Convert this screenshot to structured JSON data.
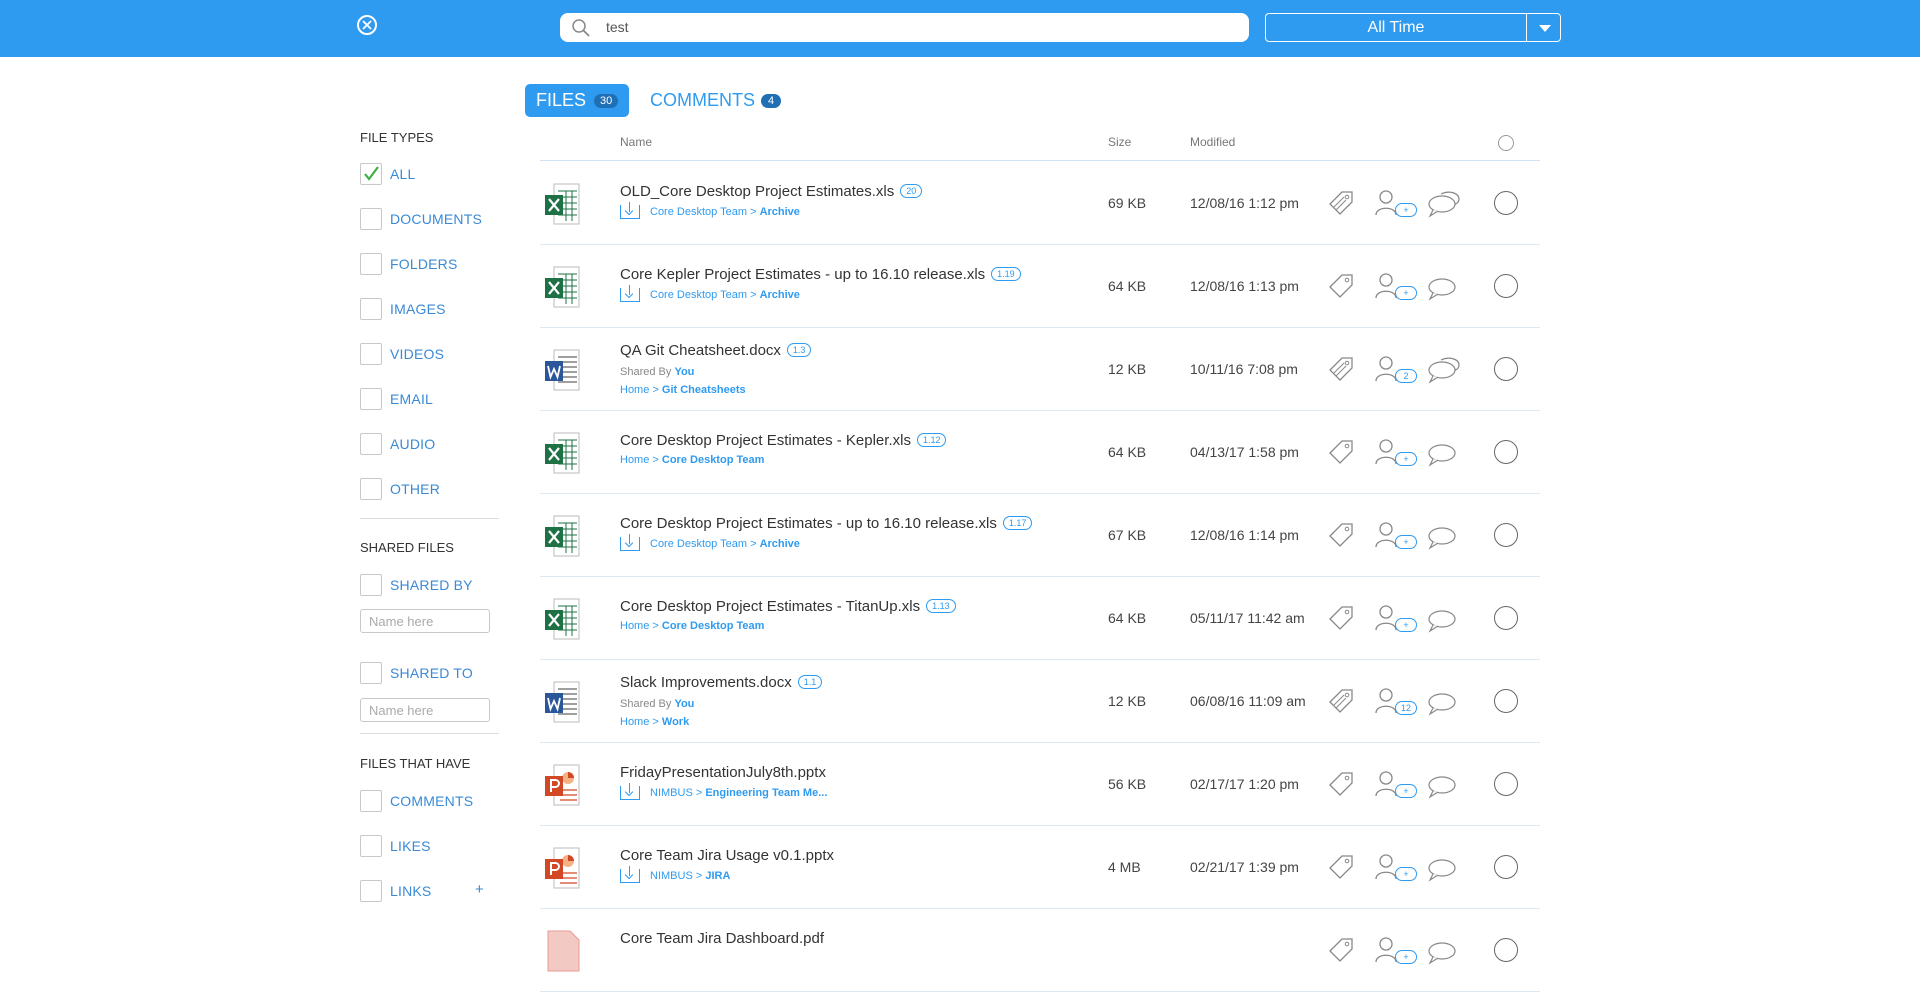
{
  "search": {
    "value": "test"
  },
  "time_filter": {
    "selected": "All Time"
  },
  "tabs": [
    {
      "label": "FILES",
      "count": "30",
      "active": true
    },
    {
      "label": "COMMENTS",
      "count": "4",
      "active": false
    }
  ],
  "sidebar": {
    "file_types_title": "FILE TYPES",
    "file_types": [
      {
        "label": "ALL",
        "checked": true
      },
      {
        "label": "DOCUMENTS",
        "checked": false
      },
      {
        "label": "FOLDERS",
        "checked": false
      },
      {
        "label": "IMAGES",
        "checked": false
      },
      {
        "label": "VIDEOS",
        "checked": false
      },
      {
        "label": "EMAIL",
        "checked": false
      },
      {
        "label": "AUDIO",
        "checked": false
      },
      {
        "label": "OTHER",
        "checked": false
      }
    ],
    "shared_title": "SHARED FILES",
    "shared_by_label": "SHARED BY",
    "shared_by_placeholder": "Name here",
    "shared_to_label": "SHARED TO",
    "shared_to_placeholder": "Name here",
    "files_have_title": "FILES THAT HAVE",
    "files_have": [
      {
        "label": "COMMENTS"
      },
      {
        "label": "LIKES"
      },
      {
        "label": "LINKS",
        "plus": "+"
      }
    ]
  },
  "columns": {
    "name": "Name",
    "size": "Size",
    "modified": "Modified"
  },
  "colors": {
    "brand": "#2f9bf0",
    "excel": "#1e7145",
    "word": "#2b579a",
    "powerpoint": "#d24726",
    "pdf": "#e04a3f"
  },
  "files": [
    {
      "type": "excel",
      "name": "OLD_Core Desktop Project Estimates.xls",
      "version": "20",
      "loc_prefix": "Core Desktop Team",
      "loc_sep": " > ",
      "loc_folder": "Archive",
      "download": true,
      "shared_label": "",
      "shared_by": "",
      "size": "69 KB",
      "modified": "12/08/16 1:12 pm",
      "tag_filled": true,
      "share_badge": "+",
      "comment_filled": true
    },
    {
      "type": "excel",
      "name": "Core Kepler Project Estimates - up to 16.10 release.xls",
      "version": "1.19",
      "loc_prefix": "Core Desktop Team",
      "loc_sep": " > ",
      "loc_folder": "Archive",
      "download": true,
      "shared_label": "",
      "shared_by": "",
      "size": "64 KB",
      "modified": "12/08/16 1:13 pm",
      "tag_filled": false,
      "share_badge": "+",
      "comment_filled": false
    },
    {
      "type": "word",
      "name": "QA Git Cheatsheet.docx",
      "version": "1.3",
      "loc_prefix": "Home",
      "loc_sep": " > ",
      "loc_folder": "Git Cheatsheets",
      "download": false,
      "shared_label": "Shared By",
      "shared_by": "You",
      "size": "12 KB",
      "modified": "10/11/16 7:08 pm",
      "tag_filled": true,
      "share_badge": "2",
      "comment_filled": true
    },
    {
      "type": "excel",
      "name": "Core Desktop Project Estimates - Kepler.xls",
      "version": "1.12",
      "loc_prefix": "Home",
      "loc_sep": " > ",
      "loc_folder": "Core Desktop Team",
      "download": false,
      "shared_label": "",
      "shared_by": "",
      "size": "64 KB",
      "modified": "04/13/17 1:58 pm",
      "tag_filled": false,
      "share_badge": "+",
      "comment_filled": false
    },
    {
      "type": "excel",
      "name": "Core Desktop Project Estimates - up to 16.10 release.xls",
      "version": "1.17",
      "loc_prefix": "Core Desktop Team",
      "loc_sep": " > ",
      "loc_folder": "Archive",
      "download": true,
      "shared_label": "",
      "shared_by": "",
      "size": "67 KB",
      "modified": "12/08/16 1:14 pm",
      "tag_filled": false,
      "share_badge": "+",
      "comment_filled": false
    },
    {
      "type": "excel",
      "name": "Core Desktop Project Estimates - TitanUp.xls",
      "version": "1.13",
      "loc_prefix": "Home",
      "loc_sep": " > ",
      "loc_folder": "Core Desktop Team",
      "download": false,
      "shared_label": "",
      "shared_by": "",
      "size": "64 KB",
      "modified": "05/11/17 11:42 am",
      "tag_filled": false,
      "share_badge": "+",
      "comment_filled": false
    },
    {
      "type": "word",
      "name": "Slack Improvements.docx",
      "version": "1.1",
      "loc_prefix": "Home",
      "loc_sep": " > ",
      "loc_folder": "Work",
      "download": false,
      "shared_label": "Shared By",
      "shared_by": "You",
      "size": "12 KB",
      "modified": "06/08/16 11:09 am",
      "tag_filled": true,
      "share_badge": "12",
      "comment_filled": false
    },
    {
      "type": "powerpoint",
      "name": "FridayPresentationJuly8th.pptx",
      "version": "",
      "loc_prefix": "NIMBUS",
      "loc_sep": " > ",
      "loc_folder": "Engineering Team Me...",
      "download": true,
      "shared_label": "",
      "shared_by": "",
      "size": "56 KB",
      "modified": "02/17/17 1:20 pm",
      "tag_filled": false,
      "share_badge": "+",
      "comment_filled": false
    },
    {
      "type": "powerpoint",
      "name": "Core Team Jira Usage v0.1.pptx",
      "version": "",
      "loc_prefix": "NIMBUS",
      "loc_sep": " > ",
      "loc_folder": "JIRA",
      "download": true,
      "shared_label": "",
      "shared_by": "",
      "size": "4 MB",
      "modified": "02/21/17 1:39 pm",
      "tag_filled": false,
      "share_badge": "+",
      "comment_filled": false
    },
    {
      "type": "pdf",
      "name": "Core Team Jira Dashboard.pdf",
      "version": "",
      "loc_prefix": "",
      "loc_sep": "",
      "loc_folder": "",
      "download": false,
      "shared_label": "",
      "shared_by": "",
      "size": "",
      "modified": "",
      "tag_filled": false,
      "share_badge": "+",
      "comment_filled": false
    }
  ]
}
